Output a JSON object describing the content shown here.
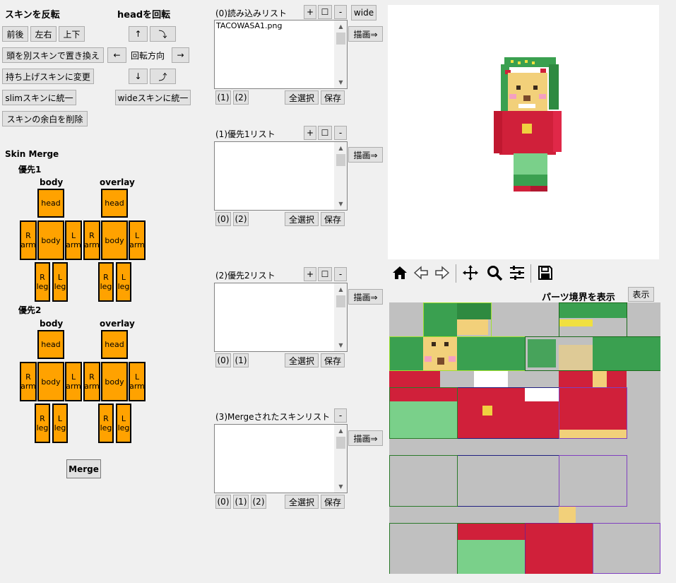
{
  "left": {
    "flip_title": "スキンを反転",
    "flip_buttons": [
      "前後",
      "左右",
      "上下"
    ],
    "rotate_title": "headを回転",
    "rotate_up": "↑",
    "rotate_left": "←",
    "rotate_right": "→",
    "rotate_down": "↓",
    "rotate_ccw": "⤵",
    "rotate_cw": "⤴",
    "rotate_dir": "回転方向",
    "replace_head": "頭を別スキンで置き換え",
    "change_pickup": "持ち上げスキンに変更",
    "unify_slim": "slimスキンに統一",
    "unify_wide": "wideスキンに統一",
    "trim_margin": "スキンの余白を削除"
  },
  "merge": {
    "title": "Skin Merge",
    "priority1": "優先1",
    "priority2": "優先2",
    "body_label": "body",
    "overlay_label": "overlay",
    "parts": {
      "head": "head",
      "body": "body",
      "r_arm": "R arm",
      "l_arm": "L arm",
      "r_leg": "R leg",
      "l_leg": "L leg"
    },
    "merge_button": "Merge"
  },
  "lists": [
    {
      "title": "(0)読み込みリスト",
      "items": [
        "TACOWASA1.png"
      ],
      "refs": [
        "(1)",
        "(2)"
      ],
      "controls": [
        "+",
        "☐",
        "-"
      ]
    },
    {
      "title": "(1)優先1リスト",
      "items": [],
      "refs": [
        "(0)",
        "(2)"
      ],
      "controls": [
        "+",
        "☐",
        "-"
      ]
    },
    {
      "title": "(2)優先2リスト",
      "items": [],
      "refs": [
        "(0)",
        "(1)"
      ],
      "controls": [
        "+",
        "☐",
        "-"
      ]
    },
    {
      "title": "(3)Mergeされたスキンリスト",
      "items": [],
      "refs": [
        "(0)",
        "(1)",
        "(2)"
      ],
      "controls": [
        "-"
      ]
    }
  ],
  "list_actions": {
    "select_all": "全選択",
    "save": "保存",
    "draw": "描画⇒",
    "wide": "wide"
  },
  "toolbar_icons": [
    "home-icon",
    "back-arrow-icon",
    "forward-arrow-icon",
    "pan-icon",
    "zoom-icon",
    "configure-icon",
    "save-icon"
  ],
  "texture": {
    "show_boundaries_label": "パーツ境界を表示",
    "show_button": "表示"
  },
  "colors": {
    "part_fill": "#ffa200",
    "button_bg": "#e1e1e1",
    "texture_bg": "#c0c0c0",
    "skin_red": "#d0203a",
    "skin_green": "#3aa050",
    "skin_face": "#f2d07a"
  }
}
